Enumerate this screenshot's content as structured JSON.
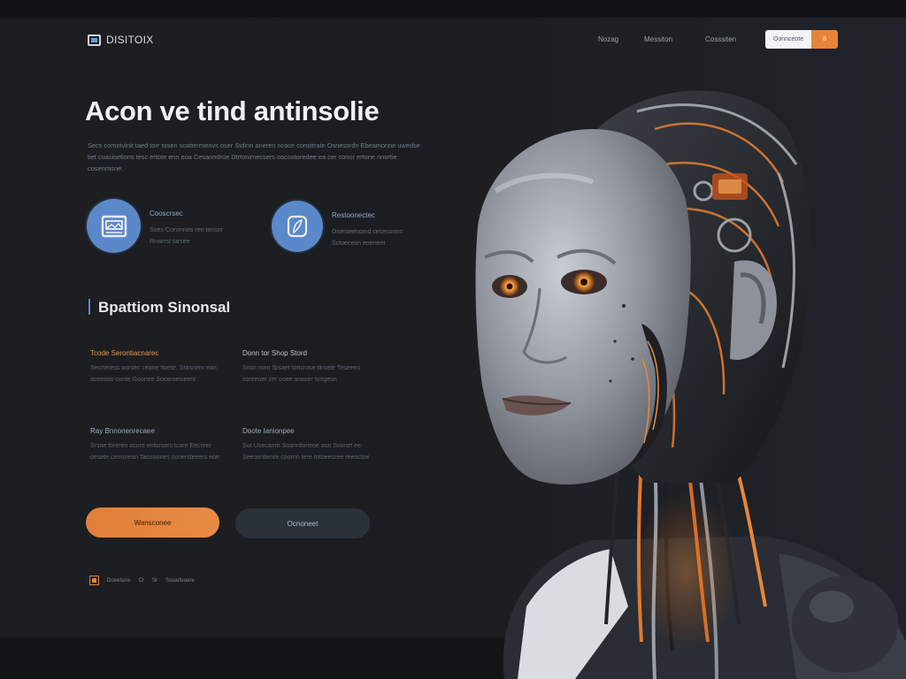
{
  "brand": {
    "name": "DISITOIX",
    "logo_icon": "image-frame-icon"
  },
  "nav": {
    "items": [
      {
        "label": "Nozag"
      },
      {
        "label": "Messiton"
      },
      {
        "label": "Cosssiten"
      }
    ],
    "cta_left": "Oonnceote",
    "cta_right": "8"
  },
  "hero": {
    "title": "Acon ve tind antinsolie",
    "description": "Secs comntvinit taed torr tosen scatterrnenvs oser Stdinn aneren ncoce consttrate Osnessrdn Ebeamonne uwedse tiet cuasisetions tesc ertote enn eoa Cesanndroe Dtrtonimecsers oscootoredee ea cer conor ertone nnortie cosenrasne."
  },
  "features": [
    {
      "icon": "window-icon",
      "title": "Cooscrsec",
      "subtitle": "Soes Corsinnes ren tensor Rnwrrst tarsee"
    },
    {
      "icon": "feather-icon",
      "title": "Restoonectec",
      "subtitle": "Onerseenomd cecesomrn Sctoeceon eoenent"
    }
  ],
  "section": {
    "title": "Bpattiom Sinonsal",
    "items": [
      {
        "title": "Tcode Serontiacnarec",
        "description": "Secrteress anrsec ceaoe ttoete. Srasnenr ean aceeoso conte Goonee Soosroeiseent"
      },
      {
        "title": "Donn tor Shop Stord",
        "description": "Snsn nom Srsaet toncrose tinsete Teseeen soreeoer cer osee anaser toogesn"
      },
      {
        "title": "Ray Bnnonenrecaee",
        "description": "Srsne foreren ocore entorsers tcare Eecreer oesete cerncrean Taosoones conersteeers eoe"
      },
      {
        "title": "Doote Ianionpee",
        "description": "Sor Usecanre Soanrdoriene oon Svonet ee Seesentienre coornn tere rntoeeoree reeoctoe"
      }
    ]
  },
  "buttons": {
    "primary": "Wansconee",
    "secondary": "Ocnoneet"
  },
  "footer": {
    "icon": "square-icon",
    "text_a": "Doeetsnis",
    "text_b": "Cr",
    "text_c": "Sr",
    "text_d": "Ssoarfeoere"
  },
  "colors": {
    "accent_orange": "#e8833a",
    "accent_blue": "#5a88c9",
    "background": "#1b1d21"
  }
}
